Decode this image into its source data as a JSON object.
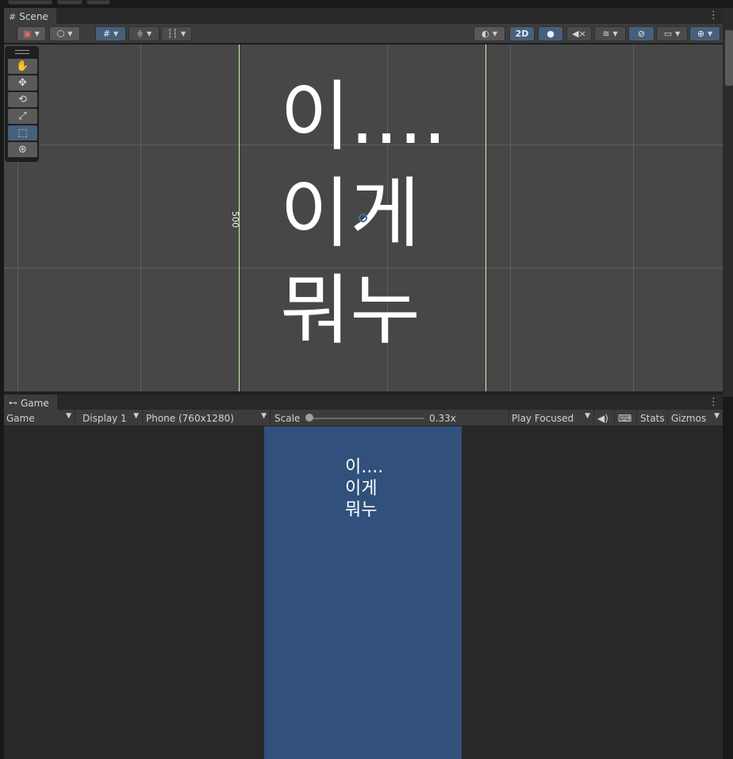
{
  "top_strip": {
    "buttons": [
      "",
      "",
      ""
    ]
  },
  "scene_panel": {
    "tab_label": "Scene",
    "tab_icon": "grid-icon",
    "toolbar": {
      "left": [
        {
          "name": "draw-mode-button",
          "icon": "draw-mode-icon",
          "glyph": "▣",
          "has_dropdown": true
        },
        {
          "name": "shading-button",
          "icon": "cube-icon",
          "glyph": "⬡",
          "has_dropdown": true
        },
        {
          "name": "grid-snap-button",
          "icon": "grid-snap-icon",
          "glyph": "#",
          "has_dropdown": true,
          "active": true
        },
        {
          "name": "increment-snap-button",
          "icon": "increment-snap-icon",
          "glyph": "⋕",
          "has_dropdown": true
        },
        {
          "name": "ruler-button",
          "icon": "ruler-icon",
          "glyph": "┆┆",
          "has_dropdown": true
        }
      ],
      "right": [
        {
          "name": "render-mode-button",
          "icon": "sphere-icon",
          "glyph": "◐",
          "has_dropdown": true
        },
        {
          "name": "2d-toggle-button",
          "label": "2D",
          "active": true
        },
        {
          "name": "lighting-toggle-button",
          "icon": "lightbulb-icon",
          "glyph": "💡",
          "active": true
        },
        {
          "name": "audio-toggle-button",
          "icon": "audio-muted-icon",
          "glyph": "◀×"
        },
        {
          "name": "effects-button",
          "icon": "layers-icon",
          "glyph": "≋",
          "has_dropdown": true
        },
        {
          "name": "visibility-toggle-button",
          "icon": "eye-slash-icon",
          "glyph": "◎̸",
          "active": true
        },
        {
          "name": "camera-button",
          "icon": "camera-icon",
          "glyph": "▭",
          "has_dropdown": true
        },
        {
          "name": "gizmos-button",
          "icon": "gizmo-icon",
          "glyph": "⊕",
          "has_dropdown": true,
          "active": true
        }
      ]
    },
    "tools": [
      {
        "name": "hand-tool",
        "icon": "hand-icon",
        "glyph": "✋"
      },
      {
        "name": "move-tool",
        "icon": "move-icon",
        "glyph": "✥"
      },
      {
        "name": "rotate-tool",
        "icon": "rotate-icon",
        "glyph": "⟲"
      },
      {
        "name": "scale-tool",
        "icon": "scale-icon",
        "glyph": "⤢"
      },
      {
        "name": "rect-tool",
        "icon": "rect-icon",
        "glyph": "⬚",
        "active": true
      },
      {
        "name": "transform-tool",
        "icon": "transform-icon",
        "glyph": "⊛"
      }
    ],
    "ruler_label": "500",
    "scene_text": "이....\n이게\n뭐누"
  },
  "game_panel": {
    "tab_label": "Game",
    "tab_icon": "gamepad-icon",
    "display_mode": "Game",
    "display": "Display 1",
    "resolution": "Phone (760x1280)",
    "scale_label": "Scale",
    "scale_value": "0.33x",
    "play_mode": "Play Focused",
    "audio_icon": "speaker-icon",
    "stats_icon": "keyboard-icon",
    "stats_label": "Stats",
    "gizmos_label": "Gizmos",
    "game_text": "이....\n이게\n뭐누",
    "colors": {
      "phone_background": "#31507b",
      "active_accent": "#46607c"
    }
  }
}
